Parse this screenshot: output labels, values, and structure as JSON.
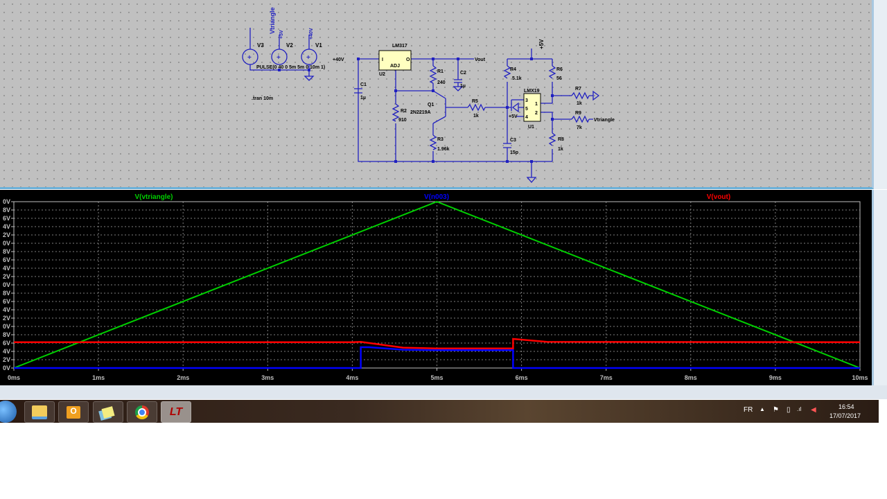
{
  "schematic": {
    "nets": {
      "vtriangle": "Vtriangle",
      "plus5": "+5V",
      "plus40": "+40V",
      "vout": "Vout",
      "plus40_in": "+40V",
      "plus5_top": "+5V",
      "plus5_u1": "+5V",
      "vtriangle_r9": "Vtriangle"
    },
    "sources": [
      {
        "name": "V3"
      },
      {
        "name": "V2"
      },
      {
        "name": "V1"
      }
    ],
    "pulse": "PULSE(0 40 0 5m 5m 0 10m 1)",
    "directive": ".tran 10m",
    "components": {
      "u2_label": "LM317",
      "u2_ref": "U2",
      "u2_i": "I",
      "u2_o": "O",
      "u2_adj": "ADJ",
      "c1": "C1",
      "c1_val": "1µ",
      "c2": "C2",
      "c2_val": "1µ",
      "r1": "R1",
      "r1_val": "240",
      "r2": "R2",
      "r2_val": "910",
      "r3": "R3",
      "r3_val": "1.96k",
      "q1": "Q1",
      "q1_val": "2N2219A",
      "r5": "R5",
      "r5_val": "1k",
      "r4": "R4",
      "r4_val": "5.1k",
      "c3": "C3",
      "c3_val": "15p",
      "r6": "R6",
      "r6_val": "56",
      "r7": "R7",
      "r7_val": "1k",
      "r9": "R9",
      "r9_val": "7k",
      "r8": "R8",
      "r8_val": "1k",
      "u1_label": "LMX19",
      "u1_ref": "U1",
      "pin3": "3",
      "pin5": "5",
      "pin4": "4",
      "pin1": "1",
      "pin2": "2"
    }
  },
  "chart_data": {
    "type": "line",
    "xlim": [
      0,
      10
    ],
    "ylim": [
      0,
      40
    ],
    "grid": true,
    "xtick_labels": [
      "0ms",
      "1ms",
      "2ms",
      "3ms",
      "4ms",
      "5ms",
      "6ms",
      "7ms",
      "8ms",
      "9ms",
      "10ms"
    ],
    "ytick_labels": [
      "0V",
      "2V",
      "4V",
      "6V",
      "8V",
      "0V",
      "2V",
      "4V",
      "6V",
      "8V",
      "0V",
      "2V",
      "4V",
      "6V",
      "8V",
      "0V",
      "2V",
      "4V",
      "6V",
      "8V",
      "0V"
    ],
    "series": [
      {
        "name": "V(vtriangle)",
        "color": "#00d000",
        "x": [
          0,
          5,
          10
        ],
        "y": [
          0,
          40,
          0
        ]
      },
      {
        "name": "V(n003)",
        "color": "#0000ff",
        "x": [
          0,
          4.1,
          4.1,
          4.2,
          4.6,
          5.0,
          5.9,
          5.9,
          10
        ],
        "y": [
          0,
          0,
          5.0,
          5.0,
          4.4,
          4.3,
          4.3,
          0,
          0
        ]
      },
      {
        "name": "V(vout)",
        "color": "#ff0000",
        "x": [
          0,
          4.0,
          4.1,
          4.6,
          5.0,
          5.9,
          5.9,
          6.3,
          10
        ],
        "y": [
          6.2,
          6.2,
          6.3,
          4.9,
          4.7,
          4.7,
          7.0,
          6.3,
          6.2
        ]
      }
    ]
  },
  "taskbar": {
    "apps": [
      {
        "icon": "windows-start-icon"
      },
      {
        "icon": "file-explorer-icon"
      },
      {
        "icon": "outlook-icon"
      },
      {
        "icon": "sticky-notes-icon"
      },
      {
        "icon": "chrome-icon"
      },
      {
        "icon": "ltspice-icon"
      }
    ],
    "lang": "FR",
    "time": "16:54",
    "date": "17/07/2017"
  }
}
